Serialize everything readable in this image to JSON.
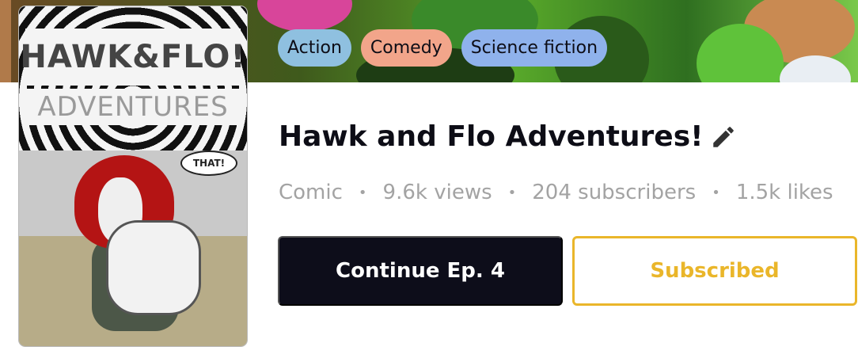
{
  "series": {
    "title": "Hawk and Flo Adventures!",
    "cover_logo_line1": "HAWK&FLO!",
    "cover_logo_line2": "ADVENTURES",
    "cover_speech": "THAT!",
    "genres": [
      "Action",
      "Comedy",
      "Science fiction"
    ],
    "meta": {
      "type": "Comic",
      "views": "9.6k views",
      "subscribers": "204 subscribers",
      "likes": "1.5k likes",
      "separator": "•"
    }
  },
  "actions": {
    "continue_label": "Continue Ep. 4",
    "subscribe_label": "Subscribed"
  },
  "icons": {
    "edit": "pencil-icon"
  },
  "colors": {
    "primary_button": "#0d0d1a",
    "subscribed_accent": "#eab62a",
    "genre_action": "#8fc0e0",
    "genre_comedy": "#f2a58a",
    "genre_scifi": "#8fb2ec",
    "meta_text": "#a3a3a3"
  }
}
